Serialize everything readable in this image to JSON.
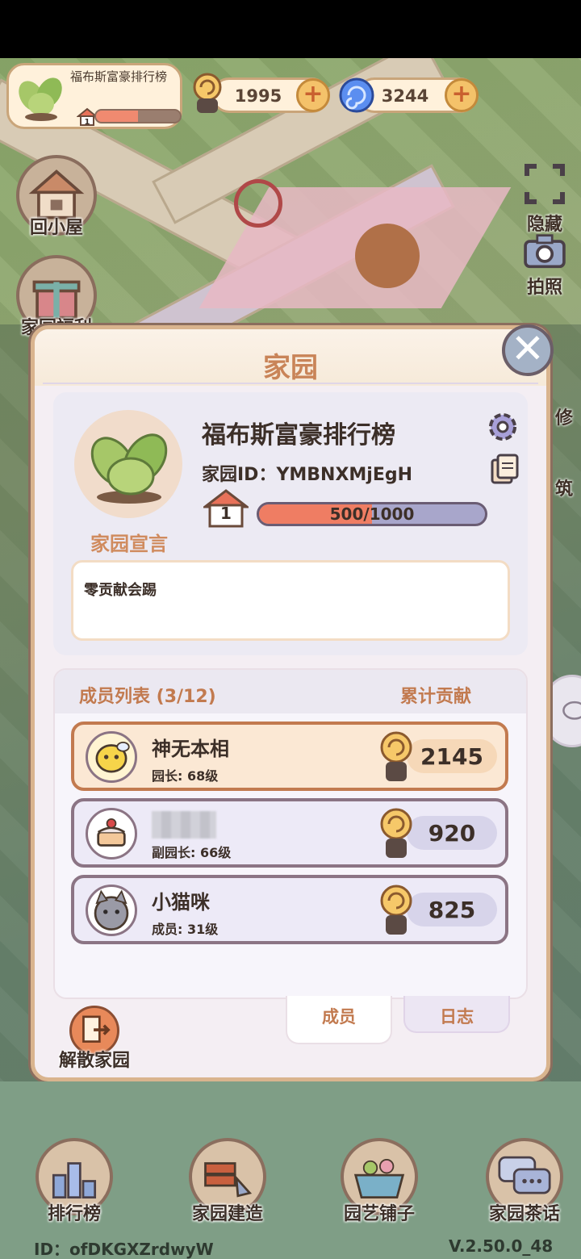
{
  "hud": {
    "garden_name": "福布斯富豪排行榜",
    "garden_level": "1",
    "level_progress": 0.5,
    "snail_coins": "1995",
    "swirl_gems": "3244",
    "plus": "+"
  },
  "side": {
    "home": "回小屋",
    "gift": "家园福利",
    "hide": "隐藏",
    "photo": "拍照",
    "repair": "修",
    "build": "筑"
  },
  "panel": {
    "title": "家园",
    "close": "✕",
    "garden_name": "福布斯富豪排行榜",
    "garden_id": "家园ID：YMBNXMjEgH",
    "level": "1",
    "exp_text": "500/1000",
    "exp_progress": 0.5,
    "manifesto_label": "家园宣言",
    "manifesto": "零贡献会踢",
    "members_title": "成员列表 (3/12)",
    "contrib_title": "累计贡献",
    "members": [
      {
        "name": "神无本相",
        "role": "园长: 68级",
        "contribution": "2145"
      },
      {
        "name": "",
        "role": "副园长: 66级",
        "contribution": "920"
      },
      {
        "name": "小猫咪",
        "role": "成员: 31级",
        "contribution": "825"
      }
    ],
    "tabs": {
      "members": "成员",
      "log": "日志"
    },
    "dissolve": "解散家园"
  },
  "nav": {
    "ranking": "排行榜",
    "build": "家园建造",
    "shop": "园艺铺子",
    "chat": "家园茶话"
  },
  "footer": {
    "id": "ID：ofDKGXZrdwyW",
    "version": "V.2.50.0_48"
  },
  "colors": {
    "accent": "#c27a4f",
    "panel_border": "#d9b48e",
    "exp_fill": "#ef7d63"
  }
}
